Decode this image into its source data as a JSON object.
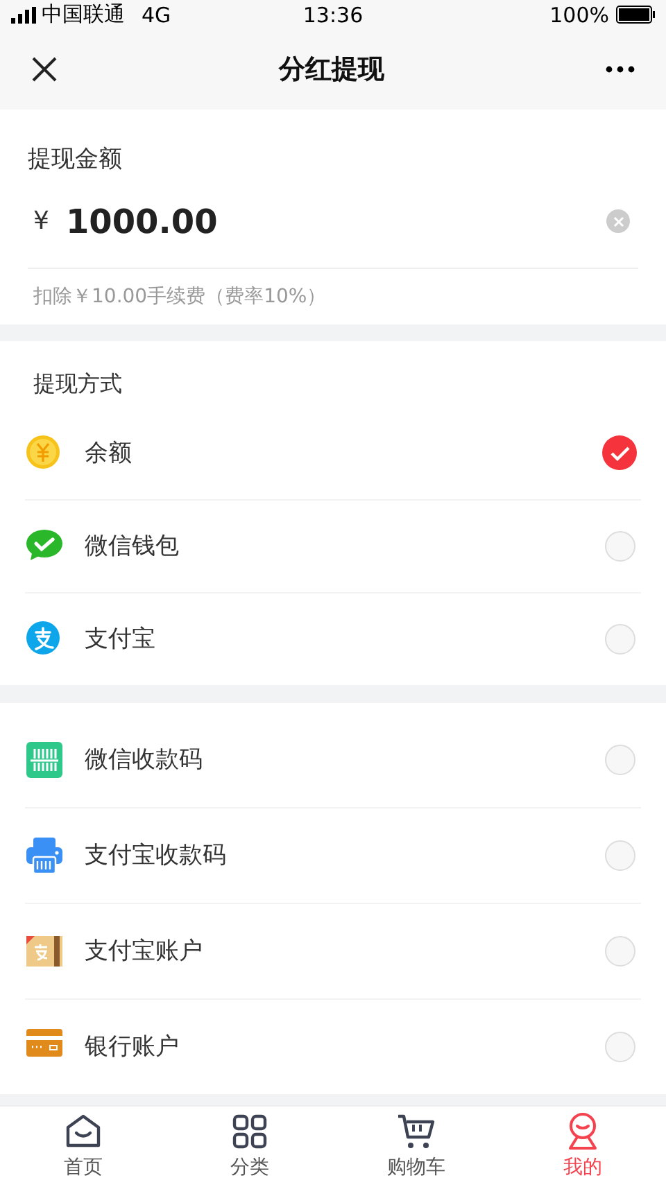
{
  "status_bar": {
    "carrier": "中国联通",
    "network": "4G",
    "time": "13:36",
    "battery": "100%"
  },
  "nav": {
    "title": "分红提现"
  },
  "amount": {
    "label": "提现金额",
    "currency": "¥",
    "value": "1000.00",
    "fee_note": "扣除￥10.00手续费（费率10%）"
  },
  "methods": {
    "header": "提现方式",
    "groups": [
      [
        {
          "kind": "coin",
          "label": "余额",
          "selected": true
        },
        {
          "kind": "wechat",
          "label": "微信钱包",
          "selected": false
        },
        {
          "kind": "alipay",
          "label": "支付宝",
          "selected": false
        }
      ],
      [
        {
          "kind": "qr",
          "label": "微信收款码",
          "selected": false
        },
        {
          "kind": "printer",
          "label": "支付宝收款码",
          "selected": false
        },
        {
          "kind": "alipay-account",
          "label": "支付宝账户",
          "selected": false
        },
        {
          "kind": "bank-card",
          "label": "银行账户",
          "selected": false
        }
      ]
    ]
  },
  "tab_bar": [
    {
      "kind": "home",
      "label": "首页",
      "selected": false
    },
    {
      "kind": "grid",
      "label": "分类",
      "selected": false
    },
    {
      "kind": "cart",
      "label": "购物车",
      "selected": false
    },
    {
      "kind": "person",
      "label": "我的",
      "selected": true
    }
  ]
}
